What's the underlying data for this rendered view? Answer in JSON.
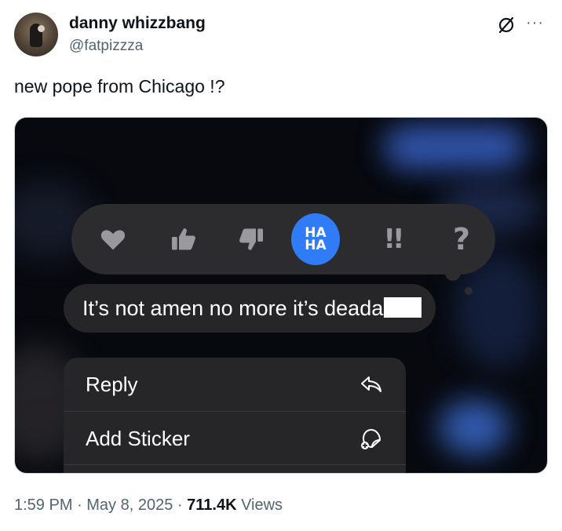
{
  "author": {
    "display_name": "danny whizzbang",
    "handle": "@fatpizzza"
  },
  "header_icons": {
    "grok": "grok-icon",
    "more": "···"
  },
  "tweet": {
    "text": "new pope from Chicago !?"
  },
  "screenshot": {
    "tapbacks": {
      "heart": "heart-icon",
      "like": "thumbs-up-icon",
      "dislike": "thumbs-down-icon",
      "haha_line1": "HA",
      "haha_line2": "HA",
      "emphasize": "!!",
      "question": "?"
    },
    "message": "It’s not amen no more it’s deada",
    "menu": {
      "reply_label": "Reply",
      "reply_icon": "reply-arrow-icon",
      "sticker_label": "Add Sticker",
      "sticker_icon": "add-sticker-icon"
    },
    "colors": {
      "haha_accent": "#2f7cf6",
      "bubble_bg": "#262628"
    }
  },
  "meta": {
    "time": "1:59 PM",
    "separator": " · ",
    "date": "May 8, 2025",
    "views_count": "711.4K",
    "views_label": " Views"
  }
}
